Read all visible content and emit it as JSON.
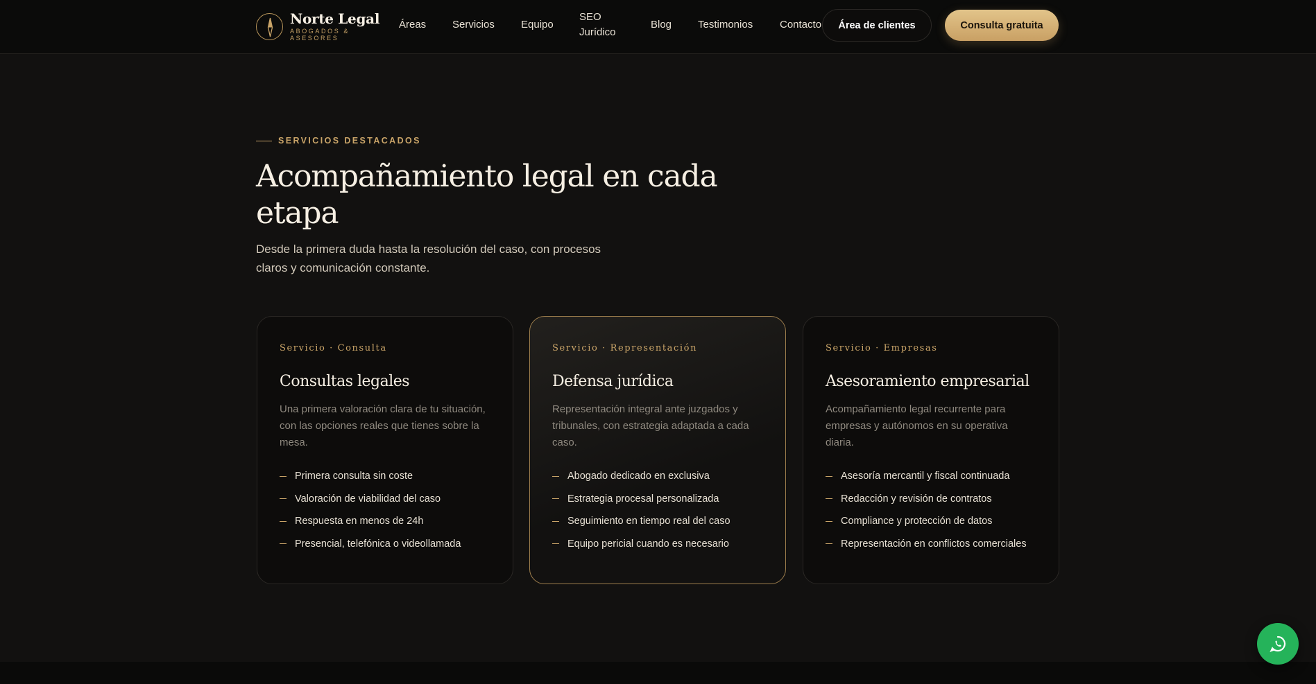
{
  "brand": {
    "name": "Norte Legal",
    "subtitle": "Abogados & Asesores"
  },
  "nav": {
    "links": [
      "Áreas",
      "Servicios",
      "Equipo",
      "SEO Jurídico",
      "Blog",
      "Testimonios",
      "Contacto"
    ],
    "clients_button": "Área de clientes",
    "consult_button": "Consulta gratuita"
  },
  "hero": {
    "eyebrow": "SERVICIOS DESTACADOS",
    "title": "Acompañamiento legal en cada etapa",
    "subtitle": "Desde la primera duda hasta la resolución del caso, con procesos claros y comunicación constante."
  },
  "cards": [
    {
      "tag": "Servicio · Consulta",
      "title": "Consultas legales",
      "description": "Una primera valoración clara de tu situación, con las opciones reales que tienes sobre la mesa.",
      "items": [
        "Primera consulta sin coste",
        "Valoración de viabilidad del caso",
        "Respuesta en menos de 24h",
        "Presencial, telefónica o videollamada"
      ]
    },
    {
      "tag": "Servicio · Representación",
      "title": "Defensa jurídica",
      "description": "Representación integral ante juzgados y tribunales, con estrategia adaptada a cada caso.",
      "items": [
        "Abogado dedicado en exclusiva",
        "Estrategia procesal personalizada",
        "Seguimiento en tiempo real del caso",
        "Equipo pericial cuando es necesario"
      ]
    },
    {
      "tag": "Servicio · Empresas",
      "title": "Asesoramiento empresarial",
      "description": "Acompañamiento legal recurrente para empresas y autónomos en su operativa diaria.",
      "items": [
        "Asesoría mercantil y fiscal continuada",
        "Redacción y revisión de contratos",
        "Compliance y protección de datos",
        "Representación en conflictos comerciales"
      ]
    }
  ],
  "colors": {
    "accent_gold": "#c9a468",
    "background": "#121110",
    "whatsapp_green": "#25b35a"
  },
  "icons": {
    "brand": "compass-icon",
    "fab": "whatsapp-icon"
  }
}
